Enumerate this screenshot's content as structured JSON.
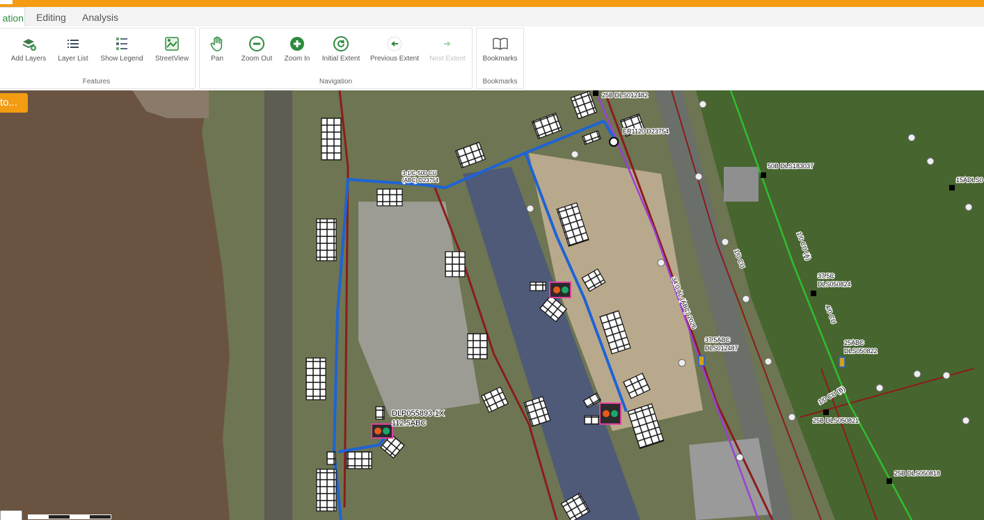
{
  "tabs": [
    {
      "label": "ation",
      "active": true
    },
    {
      "label": "Editing",
      "active": false
    },
    {
      "label": "Analysis",
      "active": false
    }
  ],
  "groups": {
    "features": {
      "label": "Features",
      "tools": [
        {
          "label": "Add Layers",
          "icon": "add-layers-icon"
        },
        {
          "label": "Layer List",
          "icon": "layer-list-icon"
        },
        {
          "label": "Show Legend",
          "icon": "legend-icon"
        },
        {
          "label": "StreetView",
          "icon": "streetview-icon"
        }
      ]
    },
    "navigation": {
      "label": "Navigation",
      "tools": [
        {
          "label": "Pan",
          "icon": "hand-icon"
        },
        {
          "label": "Zoom Out",
          "icon": "minus-circle-icon"
        },
        {
          "label": "Zoom In",
          "icon": "plus-circle-icon"
        },
        {
          "label": "Initial Extent",
          "icon": "refresh-icon"
        },
        {
          "label": "Previous Extent",
          "icon": "arrow-left-icon"
        },
        {
          "label": "Next Extent",
          "icon": "arrow-right-icon",
          "disabled": true
        }
      ]
    },
    "bookmarks": {
      "label": "Bookmarks",
      "tools": [
        {
          "label": "Bookmarks",
          "icon": "book-icon"
        }
      ]
    }
  },
  "map": {
    "goto_label": "to...",
    "labels": {
      "l1": "25B DLS012482",
      "l2": "ER1120 D23754",
      "l3": "50B DLS183037",
      "l4": "15ADLS0",
      "l5": "37.5C",
      "l6": "DLS050824",
      "l7": "37.5ABC",
      "l8": "DLS012487",
      "l9": "25ABC",
      "l10": "DLS050822",
      "l11": "25B DLS050821",
      "l12": "25B DLS050818",
      "l13": "DLP055893-1X",
      "l14": "112.5ABC",
      "l15": "3-1/C-500 CU",
      "l16": "(ABC) D23754",
      "l17": "34.0 AL (ABC) 2026",
      "l18": "1/0 CU",
      "l19": "4/0 CU",
      "l20": "1/0 CU (B)",
      "l21": "1/0 CU (A)"
    }
  },
  "colors": {
    "accent": "#f39c12",
    "ribbon_green": "#2e8b3e",
    "primary_line": "#1e63d6",
    "road_line": "#8b1c1c",
    "purple_line": "#9b3fd6",
    "green_line": "#2fbf2f"
  }
}
